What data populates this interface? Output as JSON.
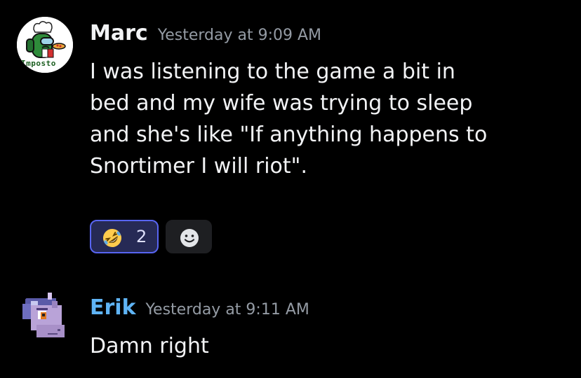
{
  "messages": [
    {
      "username": "Marc",
      "username_color": "#f2f3f5",
      "timestamp": "Yesterday at 9:09 AM",
      "avatar_icon": "among-us-crewmate-avatar",
      "avatar_caption": "Imposto",
      "lines": [
        "I was listening to the game a bit in",
        "bed and my wife was trying to sleep",
        "and she's like \"If anything happens to",
        "Snortimer I will riot\"."
      ],
      "reactions": [
        {
          "emoji": "rolling-on-the-floor-laughing",
          "count": "2",
          "active": true
        }
      ],
      "add_reaction_icon": "smiley-face-icon"
    },
    {
      "username": "Erik",
      "username_color": "#5fb4f5",
      "timestamp": "Yesterday at 9:11 AM",
      "avatar_icon": "pixel-pony-avatar",
      "lines": [
        "Damn right"
      ]
    }
  ],
  "colors": {
    "background": "#000000",
    "text": "#f2f3f5",
    "timestamp": "#949ba4",
    "reaction_active_bg": "#262a55",
    "reaction_active_border": "#5865f2"
  }
}
